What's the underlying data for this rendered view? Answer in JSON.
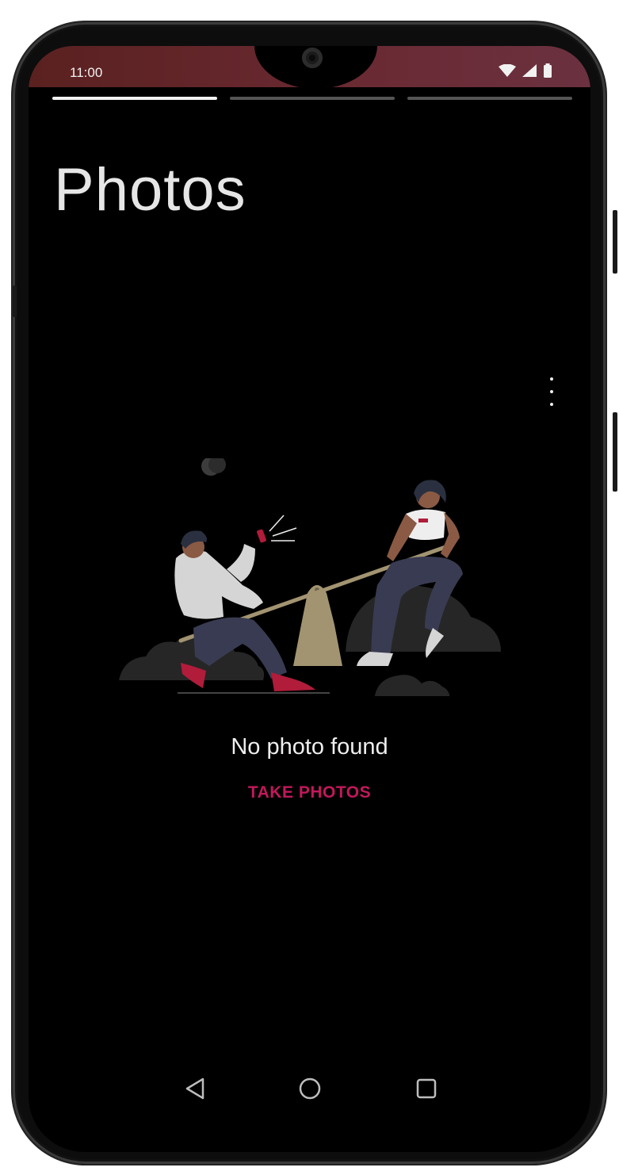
{
  "status_bar": {
    "time": "11:00",
    "icons": [
      "wifi-icon",
      "cellular-signal-icon",
      "battery-icon"
    ]
  },
  "story_progress": {
    "segments": 3,
    "active_index": 0
  },
  "page": {
    "title": "Photos"
  },
  "empty_state": {
    "message": "No photo found",
    "action_label": "TAKE PHOTOS"
  },
  "navigation_bar": {
    "icons": [
      "back-icon",
      "home-icon",
      "recents-icon"
    ]
  },
  "colors": {
    "accent": "#c2185b",
    "background": "#000000",
    "status_bar": "#5e2528"
  }
}
